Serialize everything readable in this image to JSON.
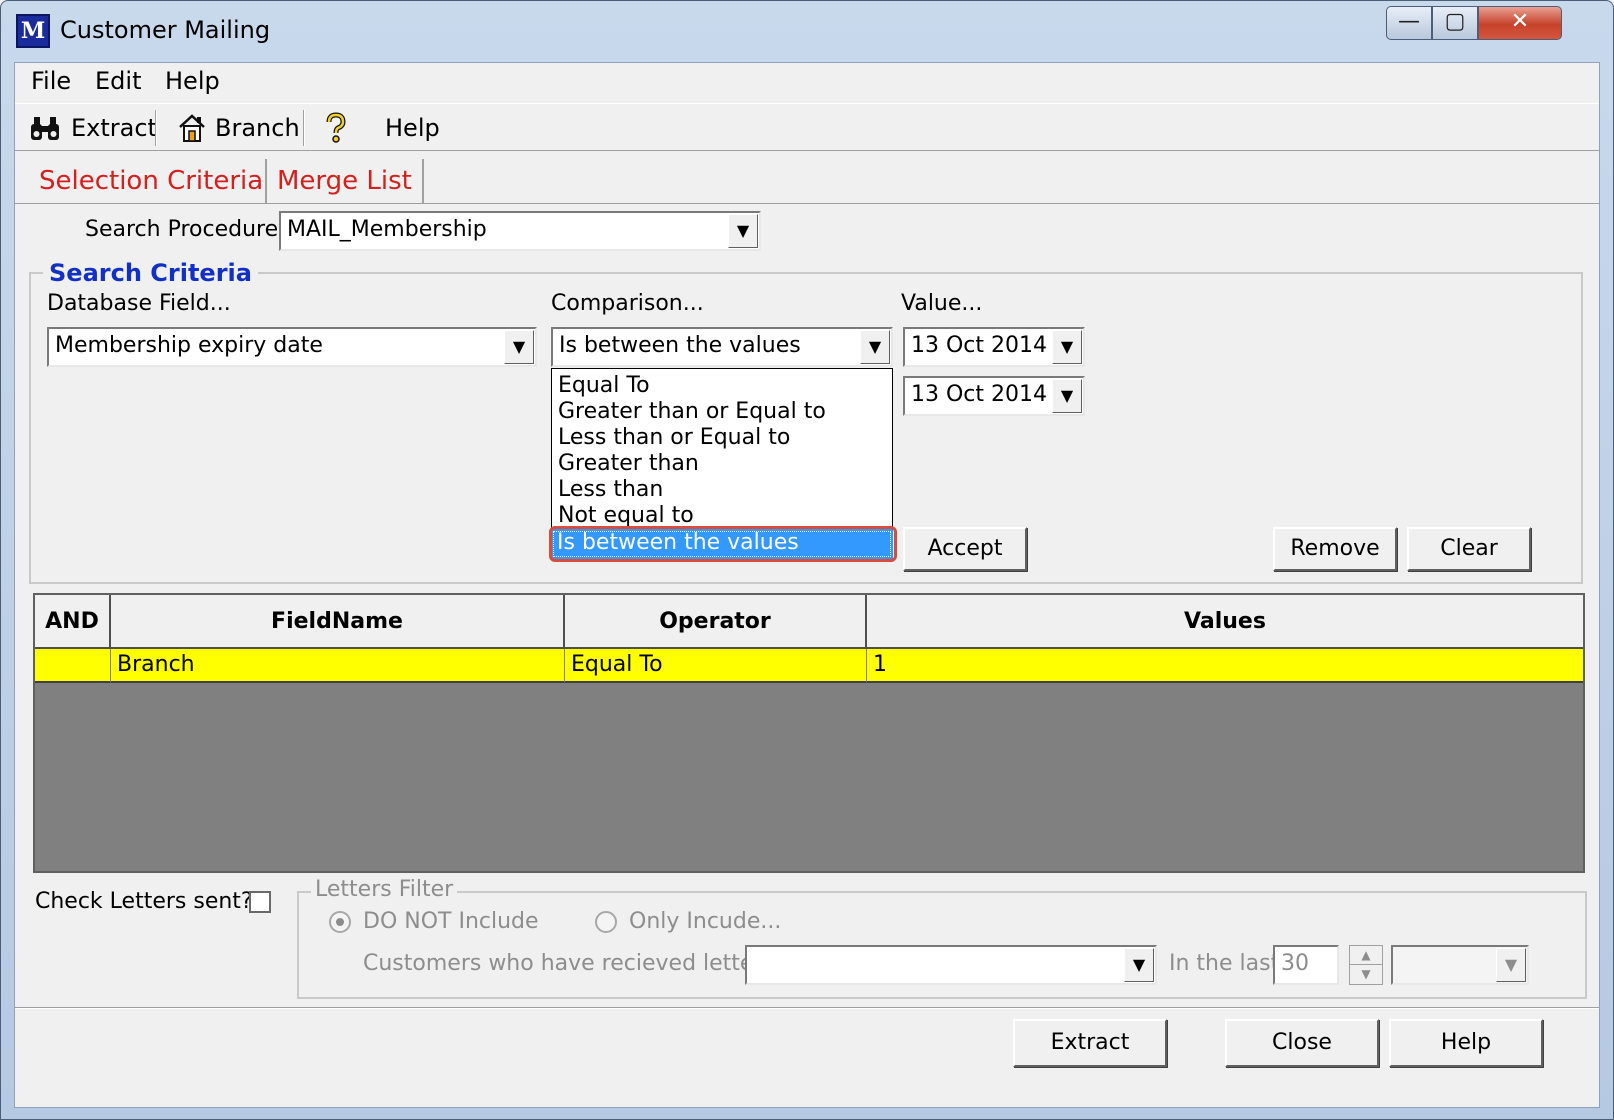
{
  "window": {
    "title": "Customer Mailing",
    "logo_text": "M",
    "min_glyph": "—",
    "max_glyph": "▢",
    "close_glyph": "✕"
  },
  "menu": [
    "File",
    "Edit",
    "Help"
  ],
  "toolbar": {
    "extract_label": "Extract",
    "branch_label": "Branch",
    "help_label": "Help"
  },
  "tabs": [
    "Selection Criteria",
    "Merge List"
  ],
  "search_procedure": {
    "label": "Search Procedure:",
    "value": "MAIL_Membership"
  },
  "search_criteria": {
    "title": "Search Criteria",
    "field_label": "Database Field...",
    "field_value": "Membership expiry date",
    "comparison_label": "Comparison...",
    "comparison_value": "Is between the values",
    "value_label": "Value...",
    "value_1": "13 Oct 2014",
    "value_2": "13 Oct 2014",
    "comparison_options": [
      "Equal To",
      "Greater than or Equal to",
      "Less than or Equal to",
      "Greater than",
      "Less than",
      "Not equal to",
      "Is between the values"
    ],
    "selected_option": "Is between the values",
    "accept_label": "Accept",
    "remove_label": "Remove",
    "clear_label": "Clear"
  },
  "grid": {
    "columns": [
      "AND",
      "FieldName",
      "Operator",
      "Values"
    ],
    "rows": [
      {
        "and": "",
        "field": "Branch",
        "operator": "Equal To",
        "values": "1"
      }
    ]
  },
  "letters": {
    "check_label": "Check Letters sent?",
    "filter_title": "Letters Filter",
    "option_exclude": "DO NOT Include",
    "option_include": "Only Incude...",
    "received_label": "Customers who have recieved letter...",
    "last_label": "In the last",
    "last_value": "30"
  },
  "footer": {
    "extract_label": "Extract",
    "close_label": "Close",
    "help_label": "Help"
  },
  "icons": {
    "extract": "binoculars-icon",
    "branch": "house-icon",
    "help": "question-icon"
  }
}
